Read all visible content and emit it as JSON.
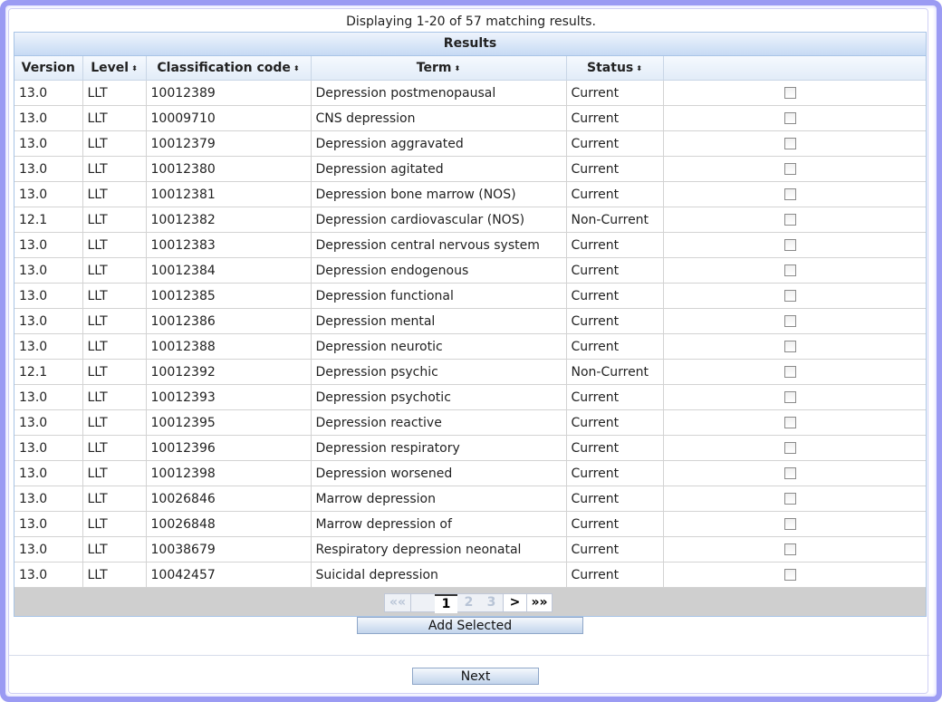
{
  "summary": "Displaying 1-20 of 57 matching results.",
  "results": {
    "title": "Results",
    "columns": [
      {
        "label": "Version",
        "sortable": false
      },
      {
        "label": "Level",
        "sortable": true
      },
      {
        "label": "Classification code",
        "sortable": true
      },
      {
        "label": "Term",
        "sortable": true
      },
      {
        "label": "Status",
        "sortable": true
      },
      {
        "label": "",
        "sortable": false
      }
    ],
    "sort_glyph": "⬍",
    "rows": [
      {
        "version": "13.0",
        "level": "LLT",
        "code": "10012389",
        "term": "Depression postmenopausal",
        "status": "Current"
      },
      {
        "version": "13.0",
        "level": "LLT",
        "code": "10009710",
        "term": "CNS depression",
        "status": "Current"
      },
      {
        "version": "13.0",
        "level": "LLT",
        "code": "10012379",
        "term": "Depression aggravated",
        "status": "Current"
      },
      {
        "version": "13.0",
        "level": "LLT",
        "code": "10012380",
        "term": "Depression agitated",
        "status": "Current"
      },
      {
        "version": "13.0",
        "level": "LLT",
        "code": "10012381",
        "term": "Depression bone marrow (NOS)",
        "status": "Current"
      },
      {
        "version": "12.1",
        "level": "LLT",
        "code": "10012382",
        "term": "Depression cardiovascular (NOS)",
        "status": "Non-Current"
      },
      {
        "version": "13.0",
        "level": "LLT",
        "code": "10012383",
        "term": "Depression central nervous system",
        "status": "Current"
      },
      {
        "version": "13.0",
        "level": "LLT",
        "code": "10012384",
        "term": "Depression endogenous",
        "status": "Current"
      },
      {
        "version": "13.0",
        "level": "LLT",
        "code": "10012385",
        "term": "Depression functional",
        "status": "Current"
      },
      {
        "version": "13.0",
        "level": "LLT",
        "code": "10012386",
        "term": "Depression mental",
        "status": "Current"
      },
      {
        "version": "13.0",
        "level": "LLT",
        "code": "10012388",
        "term": "Depression neurotic",
        "status": "Current"
      },
      {
        "version": "12.1",
        "level": "LLT",
        "code": "10012392",
        "term": "Depression psychic",
        "status": "Non-Current"
      },
      {
        "version": "13.0",
        "level": "LLT",
        "code": "10012393",
        "term": "Depression psychotic",
        "status": "Current"
      },
      {
        "version": "13.0",
        "level": "LLT",
        "code": "10012395",
        "term": "Depression reactive",
        "status": "Current"
      },
      {
        "version": "13.0",
        "level": "LLT",
        "code": "10012396",
        "term": "Depression respiratory",
        "status": "Current"
      },
      {
        "version": "13.0",
        "level": "LLT",
        "code": "10012398",
        "term": "Depression worsened",
        "status": "Current"
      },
      {
        "version": "13.0",
        "level": "LLT",
        "code": "10026846",
        "term": "Marrow depression",
        "status": "Current"
      },
      {
        "version": "13.0",
        "level": "LLT",
        "code": "10026848",
        "term": "Marrow depression of",
        "status": "Current"
      },
      {
        "version": "13.0",
        "level": "LLT",
        "code": "10038679",
        "term": "Respiratory depression neonatal",
        "status": "Current"
      },
      {
        "version": "13.0",
        "level": "LLT",
        "code": "10042457",
        "term": "Suicidal depression",
        "status": "Current"
      }
    ]
  },
  "pager": {
    "first": "««",
    "prev": "",
    "pages": [
      "1",
      "2",
      "3"
    ],
    "current_page": "1",
    "next": ">",
    "last": "»»"
  },
  "buttons": {
    "add_selected": "Add Selected",
    "next": "Next"
  }
}
